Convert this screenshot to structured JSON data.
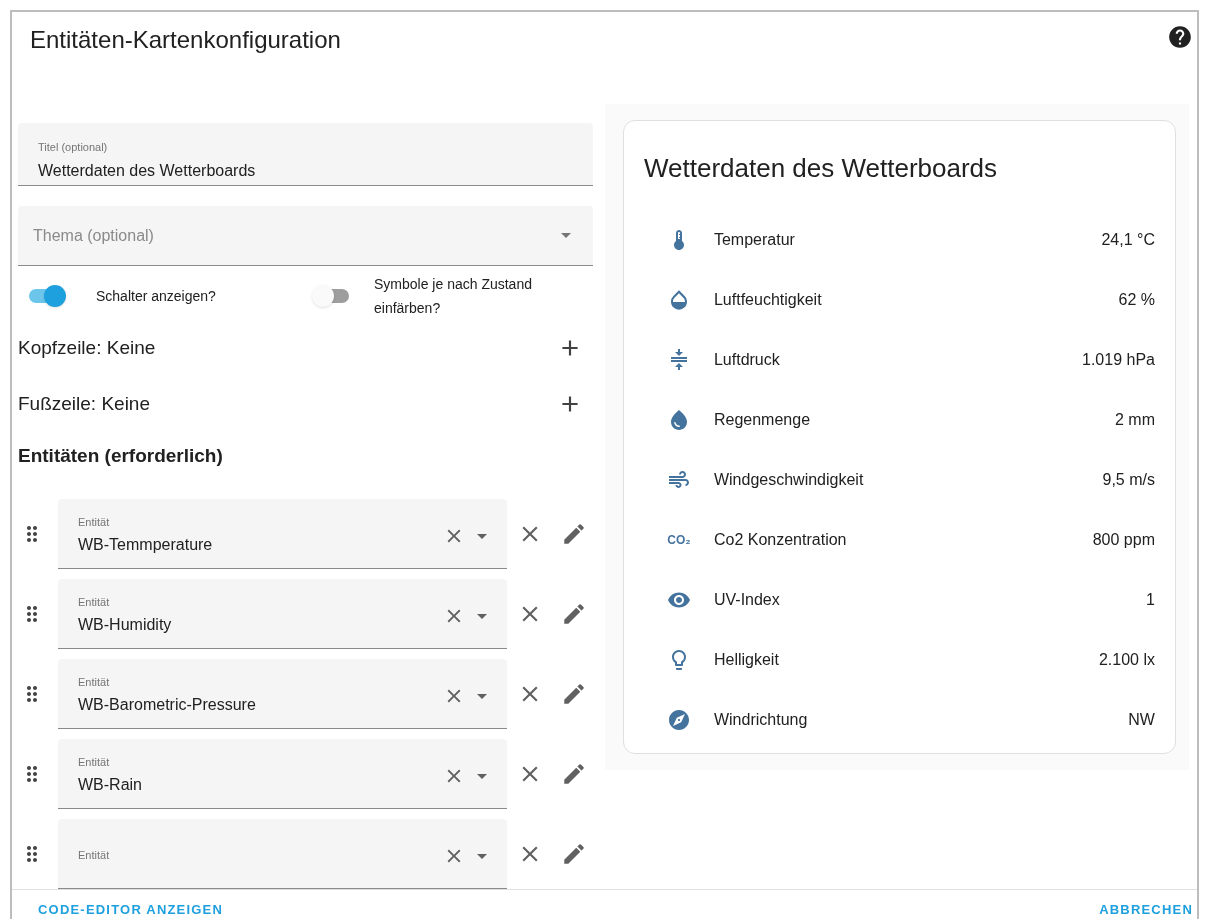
{
  "dialog": {
    "title": "Entitäten-Kartenkonfiguration"
  },
  "title_field": {
    "label": "Titel (optional)",
    "value": "Wetterdaten des Wetterboards"
  },
  "theme_field": {
    "placeholder": "Thema (optional)"
  },
  "toggles": [
    {
      "label": "Schalter anzeigen?",
      "on": true
    },
    {
      "label": "Symbole je nach Zustand einfärben?",
      "on": false
    }
  ],
  "sections": [
    {
      "label": "Kopfzeile: Keine"
    },
    {
      "label": "Fußzeile: Keine"
    }
  ],
  "entities_heading": "Entitäten (erforderlich)",
  "entities": [
    {
      "label": "Entität",
      "value": "WB-Temmperature"
    },
    {
      "label": "Entität",
      "value": "WB-Humidity"
    },
    {
      "label": "Entität",
      "value": "WB-Barometric-Pressure"
    },
    {
      "label": "Entität",
      "value": "WB-Rain"
    },
    {
      "label": "Entität"
    }
  ],
  "preview": {
    "title": "Wetterdaten des Wetterboards",
    "rows": [
      {
        "name": "Temperatur",
        "value": "24,1 °C"
      },
      {
        "name": "Luftfeuchtigkeit",
        "value": "62 %"
      },
      {
        "name": "Luftdruck",
        "value": "1.019 hPa"
      },
      {
        "name": "Regenmenge",
        "value": "2 mm"
      },
      {
        "name": "Windgeschwindigkeit",
        "value": "9,5 m/s"
      },
      {
        "name": "Co2 Konzentration",
        "value": "800 ppm",
        "icon_text": "CO₂"
      },
      {
        "name": "UV-Index",
        "value": "1"
      },
      {
        "name": "Helligkeit",
        "value": "2.100 lx"
      },
      {
        "name": "Windrichtung",
        "value": "NW"
      }
    ]
  },
  "footer": {
    "left_button": "CODE-EDITOR ANZEIGEN",
    "right_button": "ABBRECHEN"
  }
}
